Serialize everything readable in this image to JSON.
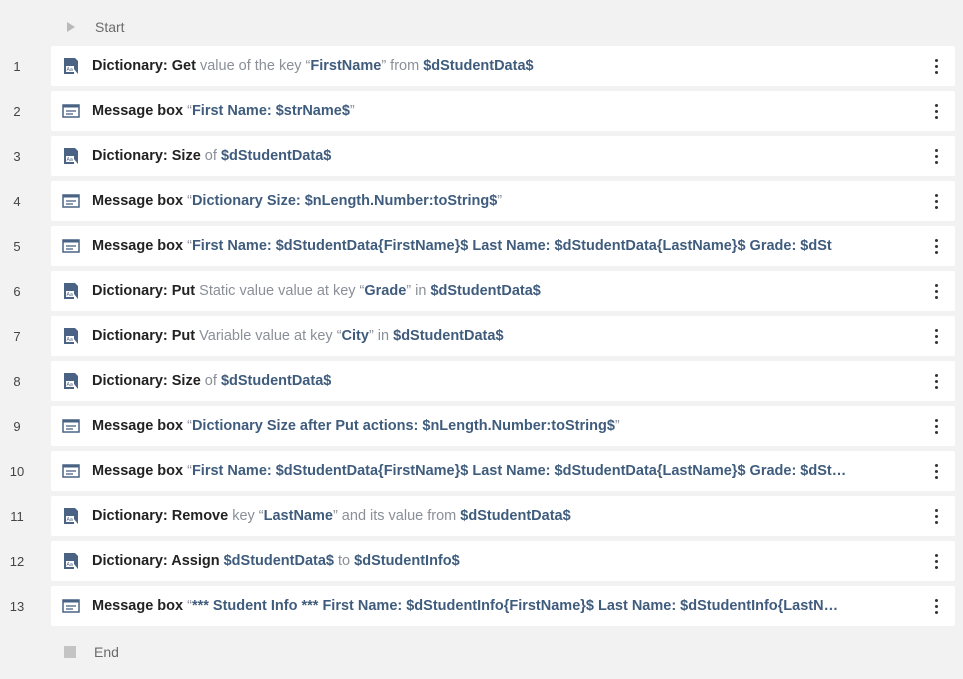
{
  "start_label": "Start",
  "end_label": "End",
  "steps": [
    {
      "num": "1",
      "icon": "dictionary-icon",
      "parts": [
        [
          "kw",
          "Dictionary: Get"
        ],
        [
          "lt",
          " value of the key “"
        ],
        [
          "var",
          "FirstName"
        ],
        [
          "lt",
          "” from "
        ],
        [
          "var",
          "$dStudentData$"
        ]
      ]
    },
    {
      "num": "2",
      "icon": "message-box-icon",
      "parts": [
        [
          "kw",
          "Message box"
        ],
        [
          "lt",
          " “"
        ],
        [
          "var",
          "First Name: $strName$"
        ],
        [
          "lt",
          "”"
        ]
      ]
    },
    {
      "num": "3",
      "icon": "dictionary-icon",
      "parts": [
        [
          "kw",
          "Dictionary: Size"
        ],
        [
          "lt",
          " of "
        ],
        [
          "var",
          "$dStudentData$"
        ]
      ]
    },
    {
      "num": "4",
      "icon": "message-box-icon",
      "parts": [
        [
          "kw",
          "Message box"
        ],
        [
          "lt",
          " “"
        ],
        [
          "var",
          "Dictionary Size: $nLength.Number:toString$"
        ],
        [
          "lt",
          "”"
        ]
      ]
    },
    {
      "num": "5",
      "icon": "message-box-icon",
      "parts": [
        [
          "kw",
          "Message box"
        ],
        [
          "lt",
          " “"
        ],
        [
          "var",
          "First Name: $dStudentData{FirstName}$ Last Name: $dStudentData{LastName}$ Grade: $dSt"
        ]
      ]
    },
    {
      "num": "6",
      "icon": "dictionary-icon",
      "parts": [
        [
          "kw",
          "Dictionary: Put"
        ],
        [
          "lt",
          " Static value value at key “"
        ],
        [
          "var",
          "Grade"
        ],
        [
          "lt",
          "” in "
        ],
        [
          "var",
          "$dStudentData$"
        ]
      ]
    },
    {
      "num": "7",
      "icon": "dictionary-icon",
      "parts": [
        [
          "kw",
          "Dictionary: Put"
        ],
        [
          "lt",
          " Variable value at key “"
        ],
        [
          "var",
          "City"
        ],
        [
          "lt",
          "” in "
        ],
        [
          "var",
          "$dStudentData$"
        ]
      ]
    },
    {
      "num": "8",
      "icon": "dictionary-icon",
      "parts": [
        [
          "kw",
          "Dictionary: Size"
        ],
        [
          "lt",
          " of "
        ],
        [
          "var",
          "$dStudentData$"
        ]
      ]
    },
    {
      "num": "9",
      "icon": "message-box-icon",
      "parts": [
        [
          "kw",
          "Message box"
        ],
        [
          "lt",
          " “"
        ],
        [
          "var",
          "Dictionary Size after Put actions: $nLength.Number:toString$"
        ],
        [
          "lt",
          "”"
        ]
      ]
    },
    {
      "num": "10",
      "icon": "message-box-icon",
      "parts": [
        [
          "kw",
          "Message box"
        ],
        [
          "lt",
          " “"
        ],
        [
          "var",
          "First Name: $dStudentData{FirstName}$ Last Name: $dStudentData{LastName}$ Grade: $dSt…"
        ]
      ]
    },
    {
      "num": "11",
      "icon": "dictionary-icon",
      "parts": [
        [
          "kw",
          "Dictionary: Remove"
        ],
        [
          "lt",
          " key “"
        ],
        [
          "var",
          "LastName"
        ],
        [
          "lt",
          "” and its value from "
        ],
        [
          "var",
          "$dStudentData$"
        ]
      ]
    },
    {
      "num": "12",
      "icon": "dictionary-icon",
      "parts": [
        [
          "kw",
          "Dictionary: Assign"
        ],
        [
          "lt",
          " "
        ],
        [
          "var",
          "$dStudentData$"
        ],
        [
          "lt",
          " to "
        ],
        [
          "var",
          "$dStudentInfo$"
        ]
      ]
    },
    {
      "num": "13",
      "icon": "message-box-icon",
      "parts": [
        [
          "kw",
          "Message box"
        ],
        [
          "lt",
          " “"
        ],
        [
          "var",
          "*** Student Info *** First Name: $dStudentInfo{FirstName}$ Last Name: $dStudentInfo{LastN…"
        ]
      ]
    }
  ],
  "colors": {
    "keyword": "#222222",
    "light": "#8a8f98",
    "variable": "#3f5c7d",
    "icon": "#4a6385"
  }
}
